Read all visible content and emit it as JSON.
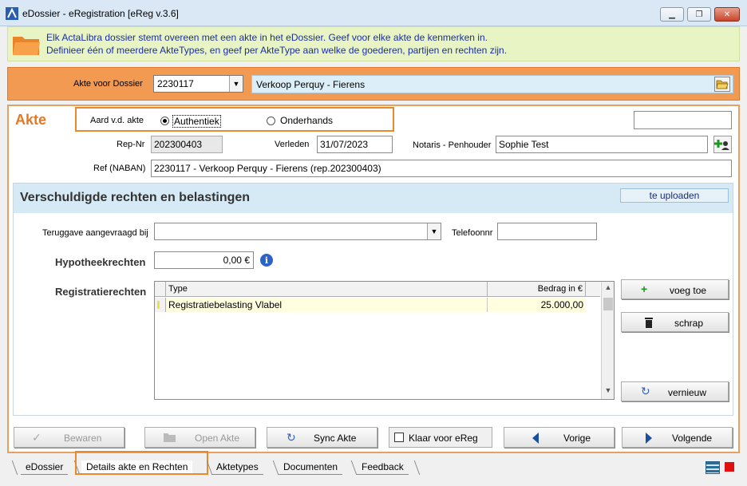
{
  "window": {
    "title": "eDossier - eRegistration [eReg v.3.6]",
    "controls": [
      "minimize",
      "restore",
      "close"
    ]
  },
  "banner": {
    "line1": "Elk ActaLibra dossier stemt overeen met een akte in het eDossier. Geef voor elke akte de kenmerken in.",
    "line2": "Definieer één of meerdere AkteTypes, en geef per AkteType aan welke de goederen, partijen en rechten zijn."
  },
  "dossier": {
    "label": "Akte voor Dossier",
    "value": "2230117",
    "description": "Verkoop Perquy - Fierens"
  },
  "akte": {
    "title": "Akte",
    "aard_label": "Aard v.d. akte",
    "aard_options": [
      "Authentiek",
      "Onderhands"
    ],
    "aard_selected": "Authentiek",
    "repnr_label": "Rep-Nr",
    "repnr_value": "202300403",
    "verleden_label": "Verleden",
    "verleden_value": "31/07/2023",
    "notaris_label": "Notaris - Penhouder",
    "notaris_value": "Sophie Test",
    "ref_label": "Ref (NABAN)",
    "ref_value": "2230117 - Verkoop Perquy - Fierens (rep.202300403)"
  },
  "rechten": {
    "title": "Verschuldigde rechten en belastingen",
    "badge": "te uploaden",
    "teruggave_label": "Teruggave aangevraagd bij",
    "teruggave_value": "",
    "telefoon_label": "Telefoonnr",
    "telefoon_value": "",
    "hypotheek_label": "Hypotheekrechten",
    "hypotheek_value": "0,00 €",
    "registratie_label": "Registratierechten",
    "grid": {
      "columns": [
        "Type",
        "Bedrag in €"
      ],
      "rows": [
        {
          "type": "Registratiebelasting Vlabel",
          "amount": "25.000,00"
        }
      ]
    },
    "buttons": {
      "add": "voeg toe",
      "delete": "schrap",
      "refresh": "vernieuw"
    }
  },
  "bottom_buttons": {
    "bewaren": "Bewaren",
    "openakte": "Open Akte",
    "sync": "Sync Akte",
    "klaar": "Klaar voor eReg",
    "klaar_checked": false,
    "vorige": "Vorige",
    "volgende": "Volgende"
  },
  "tabs": [
    {
      "label": "eDossier",
      "active": false
    },
    {
      "label": "Details akte en Rechten",
      "active": true
    },
    {
      "label": "Aktetypes",
      "active": false
    },
    {
      "label": "Documenten",
      "active": false
    },
    {
      "label": "Feedback",
      "active": false
    }
  ],
  "colors": {
    "accent_orange": "#e87722",
    "banner_bg": "#e8f4c4",
    "banner_text": "#1b2da6",
    "header_blue": "#d6eaf5",
    "status_red": "#e01010"
  }
}
